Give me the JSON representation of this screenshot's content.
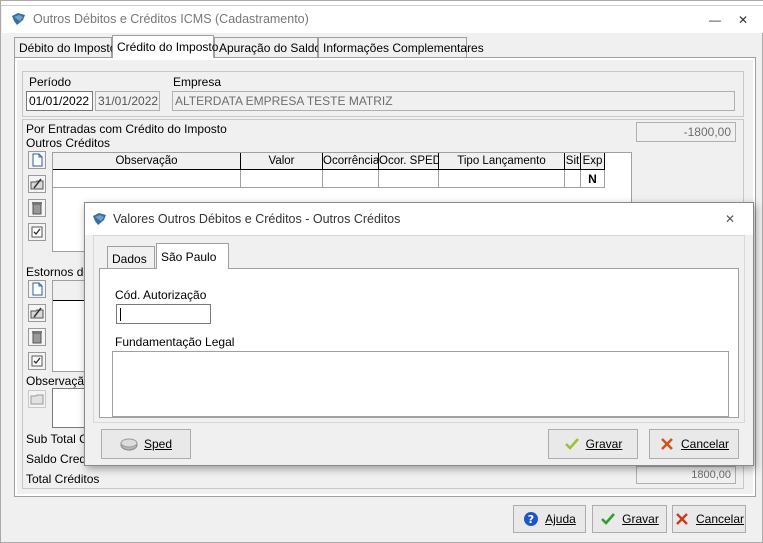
{
  "window": {
    "title": "Outros Débitos e Créditos ICMS (Cadastramento)",
    "minimize_glyph": "—",
    "close_glyph": "✕"
  },
  "tabs": [
    {
      "label": "Débito do Imposto"
    },
    {
      "label": "Crédito do Imposto"
    },
    {
      "label": "Apuração do Saldo"
    },
    {
      "label": "Informações Complementares"
    }
  ],
  "periodo": {
    "label": "Período",
    "inicio": "01/01/2022",
    "fim": "31/01/2022"
  },
  "empresa": {
    "label": "Empresa",
    "value": "ALTERDATA EMPRESA TESTE MATRIZ"
  },
  "entradas": {
    "label": "Por Entradas com Crédito do Imposto",
    "value": "-1800,00"
  },
  "outros_creditos": {
    "label": "Outros Créditos",
    "columns": [
      "Observação",
      "Valor",
      "Ocorrência",
      "Ocor. SPED",
      "Tipo Lançamento",
      "Sit",
      "Exp"
    ],
    "row": {
      "exp": "N"
    }
  },
  "estornos": {
    "label": "Estornos de"
  },
  "observacao": {
    "label": "Observação"
  },
  "totals": {
    "sub_total": "Sub Total Cr",
    "saldo_credor": "Saldo Credo",
    "total_creditos": "Total Créditos",
    "total_creditos_value": "1800,00"
  },
  "bottom_buttons": {
    "ajuda": "Ajuda",
    "gravar": "Gravar",
    "cancelar": "Cancelar"
  },
  "dialog": {
    "title": "Valores Outros Débitos e Créditos - Outros Créditos",
    "close_glyph": "✕",
    "tabs": [
      {
        "label": "Dados"
      },
      {
        "label": "São Paulo"
      }
    ],
    "cod_autorizacao": {
      "label": "Cód. Autorização",
      "value": ""
    },
    "fundamentacao": {
      "label": "Fundamentação Legal",
      "value": ""
    },
    "buttons": {
      "sped": "Sped",
      "gravar": "Gravar",
      "cancelar": "Cancelar"
    }
  },
  "colors": {
    "accent_green": "#2e9e2e",
    "accent_red": "#cc3a1e",
    "help_blue": "#1e56c8"
  }
}
